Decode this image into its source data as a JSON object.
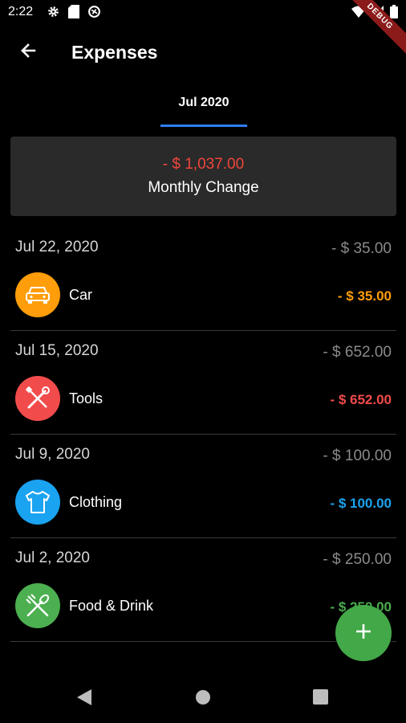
{
  "status_bar": {
    "time": "2:22",
    "icons_left": [
      "gear-icon",
      "sd-card-icon",
      "sync-icon"
    ],
    "icons_right": [
      "wifi-icon",
      "signal-icon",
      "battery-icon"
    ]
  },
  "debug_banner": "DEBUG",
  "app_bar": {
    "title": "Expenses",
    "back_icon": "arrow-left-icon"
  },
  "tabs": [
    {
      "label": "Jul 2020",
      "selected": true
    }
  ],
  "summary": {
    "amount": "- $ 1,037.00",
    "label": "Monthly Change",
    "amount_color": "#f0463c"
  },
  "days": [
    {
      "date": "Jul 22, 2020",
      "total": "- $ 35.00",
      "entry": {
        "label": "Car",
        "amount": "- $ 35.00",
        "icon": "car-icon",
        "color": "#ff9d0a"
      }
    },
    {
      "date": "Jul 15, 2020",
      "total": "- $ 652.00",
      "entry": {
        "label": "Tools",
        "amount": "- $ 652.00",
        "icon": "tools-icon",
        "color": "#f24b4b"
      }
    },
    {
      "date": "Jul 9, 2020",
      "total": "- $ 100.00",
      "entry": {
        "label": "Clothing",
        "amount": "- $ 100.00",
        "icon": "shirt-icon",
        "color": "#1aa3f0"
      }
    },
    {
      "date": "Jul 2, 2020",
      "total": "- $ 250.00",
      "entry": {
        "label": "Food & Drink",
        "amount": "- $ 250.00",
        "icon": "cutlery-icon",
        "color": "#4caf50"
      }
    }
  ],
  "fab": {
    "icon": "plus-icon",
    "color": "#43a848"
  },
  "nav_bar": {
    "buttons": [
      "back-triangle-icon",
      "home-circle-icon",
      "recents-square-icon"
    ]
  }
}
